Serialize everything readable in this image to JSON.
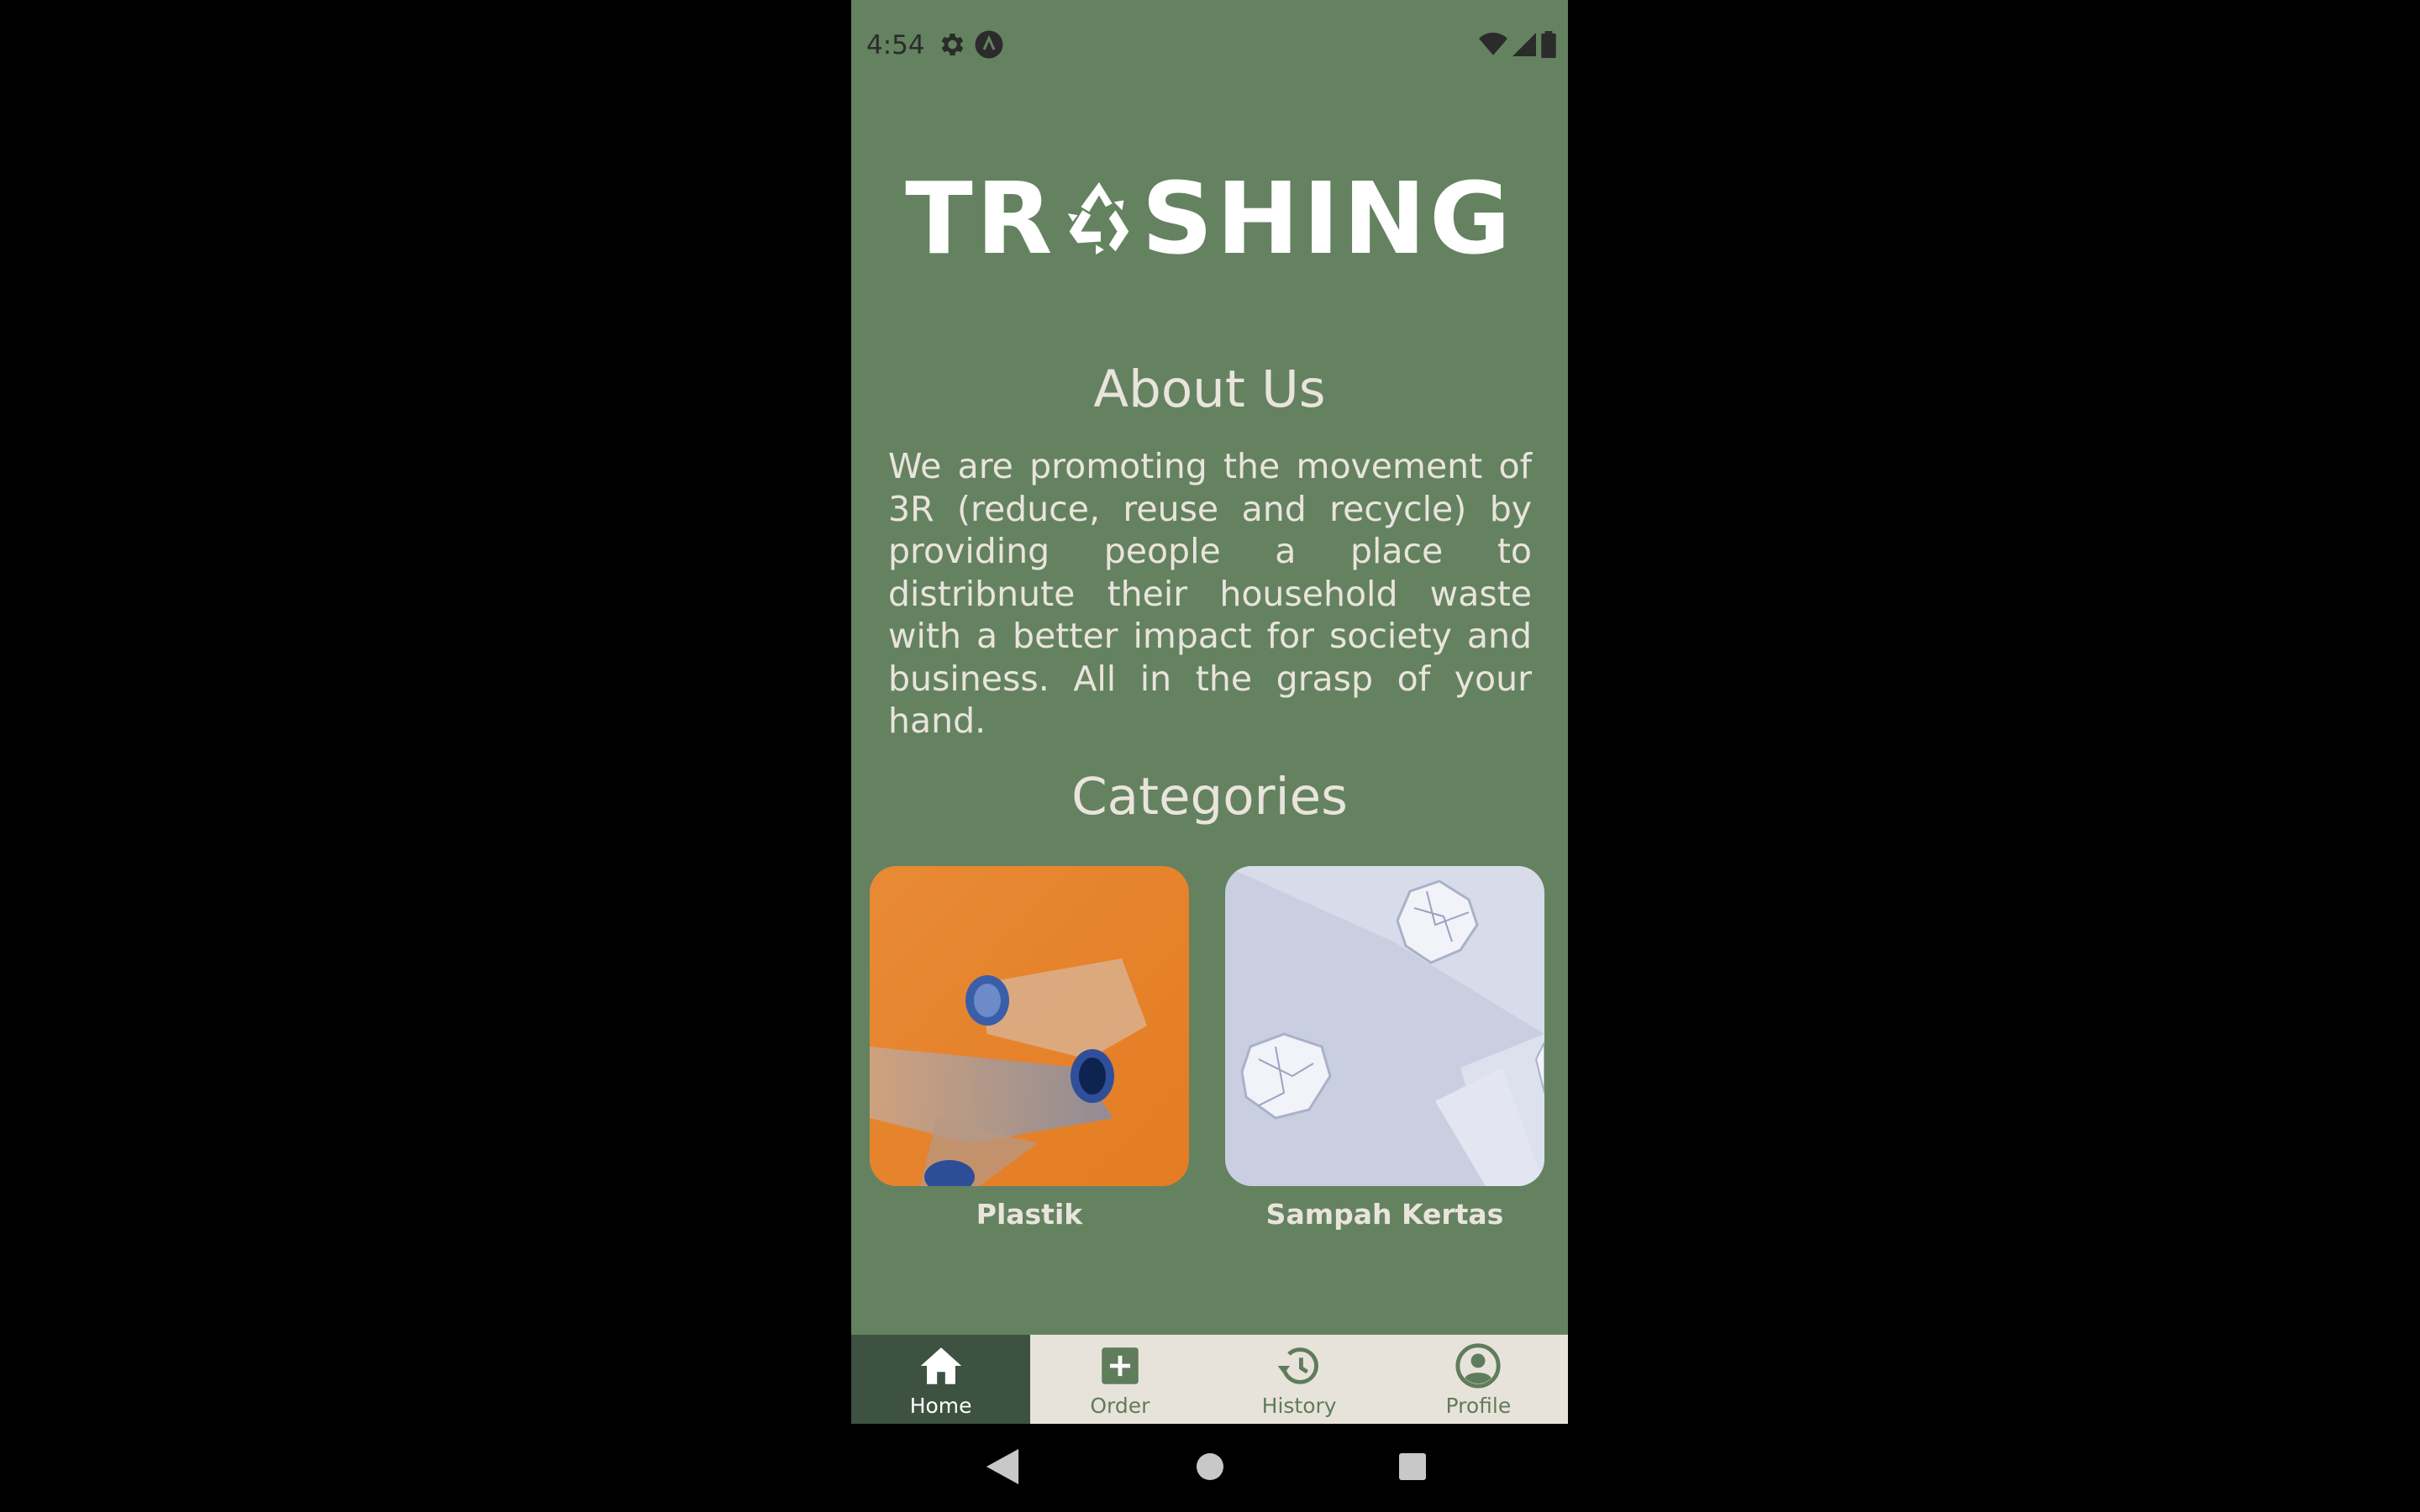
{
  "status_bar": {
    "time": "4:54",
    "icons_left": [
      "gear-icon",
      "a-badge-icon"
    ],
    "icons_right": [
      "wifi-icon",
      "cell-signal-icon",
      "battery-icon"
    ]
  },
  "logo": {
    "text_left": "TR",
    "text_right": "SHING",
    "icon": "recycle-icon"
  },
  "about": {
    "title": "About Us",
    "body": "We are promoting the movement of 3R (reduce, reuse and recycle) by providing people a place to distribnute their household waste with a better impact for society and business. All in the grasp of your hand."
  },
  "categories": {
    "title": "Categories",
    "items": [
      {
        "label": "Plastik",
        "image": "plastic-bottles-image"
      },
      {
        "label": "Sampah Kertas",
        "image": "crumpled-paper-image"
      }
    ]
  },
  "bottom_nav": {
    "items": [
      {
        "label": "Home",
        "icon": "home-icon",
        "active": true
      },
      {
        "label": "Order",
        "icon": "add-box-icon",
        "active": false
      },
      {
        "label": "History",
        "icon": "history-icon",
        "active": false
      },
      {
        "label": "Profile",
        "icon": "profile-icon",
        "active": false
      }
    ]
  },
  "colors": {
    "background": "#648260",
    "text": "#e9e4dc",
    "nav_bg": "#e8e3da",
    "nav_active": "#3d5240",
    "nav_inactive": "#5f7c5b"
  }
}
